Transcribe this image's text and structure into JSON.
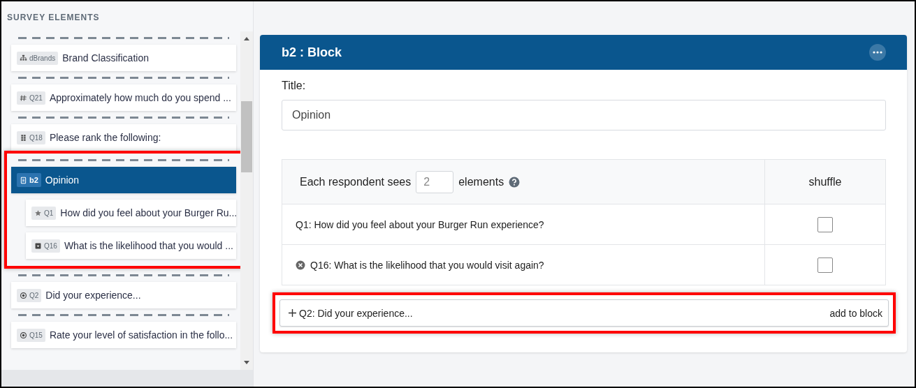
{
  "sidebar": {
    "title": "SURVEY ELEMENTS",
    "items": [
      {
        "kind": "classification",
        "tag": "dBrands",
        "text": "Brand Classification",
        "selected": false
      },
      {
        "kind": "number",
        "tag": "Q21",
        "text": "Approximately how much do you spend ...",
        "selected": false
      },
      {
        "kind": "rank",
        "tag": "Q18",
        "text": "Please rank the following:",
        "selected": false
      },
      {
        "kind": "block",
        "tag": "b2",
        "text": "Opinion",
        "selected": true,
        "highlighted": true,
        "children": [
          {
            "kind": "rating",
            "tag": "Q1",
            "text": "How did you feel about your Burger Ru...",
            "selected": false
          },
          {
            "kind": "dropdown",
            "tag": "Q16",
            "text": "What is the likelihood that you would ...",
            "selected": false
          }
        ]
      },
      {
        "kind": "choice",
        "tag": "Q2",
        "text": "Did your experience...",
        "selected": false
      },
      {
        "kind": "choice",
        "tag": "Q15",
        "text": "Rate your level of satisfaction in the follo...",
        "selected": false
      }
    ]
  },
  "panel": {
    "title": "b2 : Block",
    "title_label": "Title:",
    "title_value": "Opinion",
    "each_prefix": "Each respondent sees",
    "count": "2",
    "each_suffix": "elements",
    "shuffle_header": "shuffle",
    "rows": [
      {
        "text": "Q1: How did you feel about your Burger Run experience?",
        "removable": false,
        "shuffle": false
      },
      {
        "text": "Q16: What is the likelihood that you would visit again?",
        "removable": true,
        "shuffle": false
      }
    ],
    "add_row": {
      "text": "Q2: Did your experience...",
      "action": "add to block",
      "highlighted": true
    }
  }
}
